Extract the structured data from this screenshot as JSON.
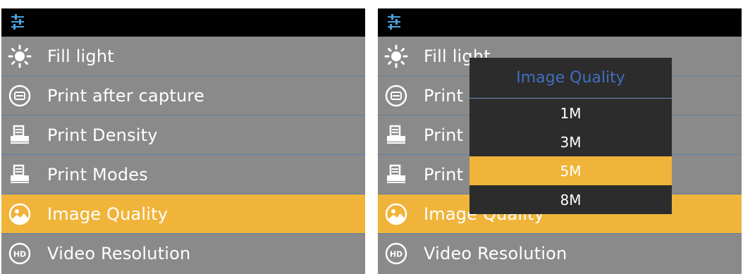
{
  "left": {
    "menu": [
      {
        "label": "Fill light",
        "icon": "sun-icon"
      },
      {
        "label": "Print after capture",
        "icon": "print-after-capture-icon"
      },
      {
        "label": "Print Density",
        "icon": "printer-icon"
      },
      {
        "label": "Print Modes",
        "icon": "printer-icon"
      },
      {
        "label": "Image Quality",
        "icon": "image-icon",
        "selected": true
      },
      {
        "label": "Video Resolution",
        "icon": "hd-icon"
      }
    ]
  },
  "right": {
    "menu": [
      {
        "label": "Fill light",
        "icon": "sun-icon"
      },
      {
        "label": "Print after capture",
        "icon": "print-after-capture-icon"
      },
      {
        "label": "Print Density",
        "icon": "printer-icon"
      },
      {
        "label": "Print Modes",
        "icon": "printer-icon"
      },
      {
        "label": "Image Quality",
        "icon": "image-icon",
        "selected": true
      },
      {
        "label": "Video Resolution",
        "icon": "hd-icon"
      }
    ],
    "popup": {
      "title": "Image Quality",
      "options": [
        "1M",
        "3M",
        "5M",
        "8M"
      ],
      "selected": "5M"
    }
  },
  "colors": {
    "highlight": "#f0b43a",
    "menu_bg": "#8a8a8a",
    "divider": "#5a7fa6",
    "popup_bg": "#2c2c2c",
    "popup_title": "#3f6fc0",
    "settings_icon": "#4aa3e0"
  }
}
